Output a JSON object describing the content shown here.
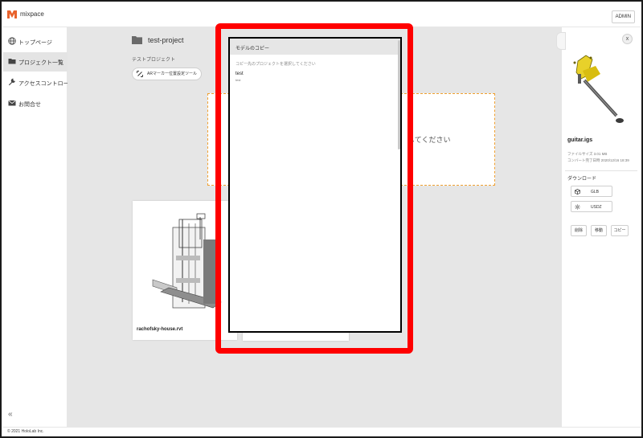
{
  "header": {
    "app_name": "mixpace",
    "admin_label": "ADMIN",
    "brand_color": "#e8622c"
  },
  "sidebar": {
    "items": [
      {
        "label": "トップページ",
        "icon": "globe-icon",
        "active": false
      },
      {
        "label": "プロジェクト一覧",
        "icon": "folder-icon",
        "active": true
      },
      {
        "label": "アクセスコントロール",
        "icon": "wrench-icon",
        "active": false
      },
      {
        "label": "お問合せ",
        "icon": "mail-icon",
        "active": false
      }
    ],
    "collapse_icon": "«"
  },
  "footer": {
    "copyright": "© 2021 HoloLab Inc."
  },
  "main": {
    "project_title": "test-project",
    "project_description": "テストプロジェクト",
    "ar_button_label": "ARマーカー位置設定ツール",
    "dropzone_text": "してください",
    "dropzone_border_color": "#f0a030",
    "cards": [
      {
        "title": "rachofsky-house.rvt"
      }
    ]
  },
  "modal": {
    "title": "モデルのコピー",
    "hint": "コピー先のプロジェクトを選択してください",
    "items": [
      {
        "name": "test",
        "description": "test"
      }
    ],
    "highlight_color": "#ff0000"
  },
  "detail_panel": {
    "close_label": "x",
    "file_name": "guitar.igs",
    "file_size": "ファイルサイズ 3.01 MB",
    "converted_at": "コンバート完了日時 2020/12/16 18:39",
    "download_label": "ダウンロード",
    "downloads": [
      {
        "label": "GLB",
        "icon": "cube-icon"
      },
      {
        "label": "USDZ",
        "icon": "sparkle-icon"
      }
    ],
    "actions": {
      "delete_label": "削除",
      "move_label": "移動",
      "copy_label": "コピー"
    }
  }
}
